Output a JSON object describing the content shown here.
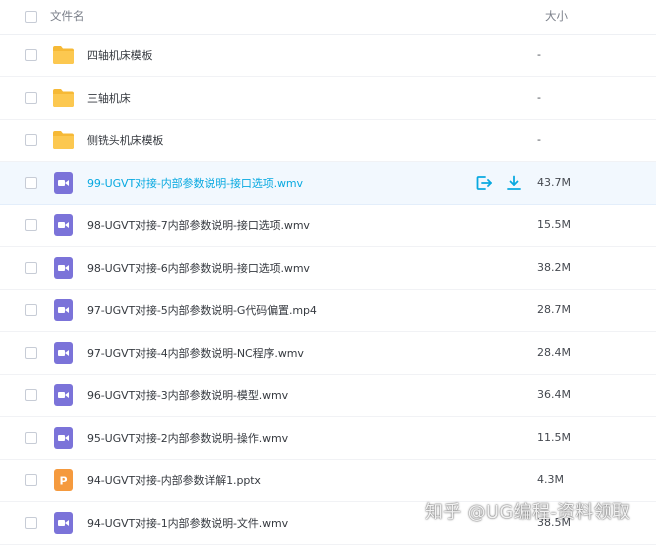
{
  "header": {
    "name_label": "文件名",
    "size_label": "大小"
  },
  "files": [
    {
      "name": "四轴机床模板",
      "size": "-",
      "type": "folder"
    },
    {
      "name": "三轴机床",
      "size": "-",
      "type": "folder"
    },
    {
      "name": "侧铣头机床模板",
      "size": "-",
      "type": "folder"
    },
    {
      "name": "99-UGVT对接-内部参数说明-接口选项.wmv",
      "size": "43.7M",
      "type": "video"
    },
    {
      "name": "98-UGVT对接-7内部参数说明-接口选项.wmv",
      "size": "15.5M",
      "type": "video"
    },
    {
      "name": "98-UGVT对接-6内部参数说明-接口选项.wmv",
      "size": "38.2M",
      "type": "video"
    },
    {
      "name": "97-UGVT对接-5内部参数说明-G代码偏置.mp4",
      "size": "28.7M",
      "type": "video"
    },
    {
      "name": "97-UGVT对接-4内部参数说明-NC程序.wmv",
      "size": "28.4M",
      "type": "video"
    },
    {
      "name": "96-UGVT对接-3内部参数说明-模型.wmv",
      "size": "36.4M",
      "type": "video"
    },
    {
      "name": "95-UGVT对接-2内部参数说明-操作.wmv",
      "size": "11.5M",
      "type": "video"
    },
    {
      "name": "94-UGVT对接-内部参数详解1.pptx",
      "size": "4.3M",
      "type": "ppt"
    },
    {
      "name": "94-UGVT对接-1内部参数说明-文件.wmv",
      "size": "38.5M",
      "type": "video"
    }
  ],
  "row_actions": {
    "share_icon": "share-icon",
    "download_icon": "download-icon"
  },
  "icons": {
    "folder": "folder-icon",
    "video": "video-file-icon",
    "ppt": "ppt-file-icon",
    "ppt_letter": "P"
  },
  "colors": {
    "accent": "#09a9e0",
    "folder": "#fcc850",
    "video": "#7b73d9",
    "ppt": "#f59a3e",
    "hover_row": "#f2f8fe"
  },
  "watermark": "知乎 @UG编程-资料领取"
}
